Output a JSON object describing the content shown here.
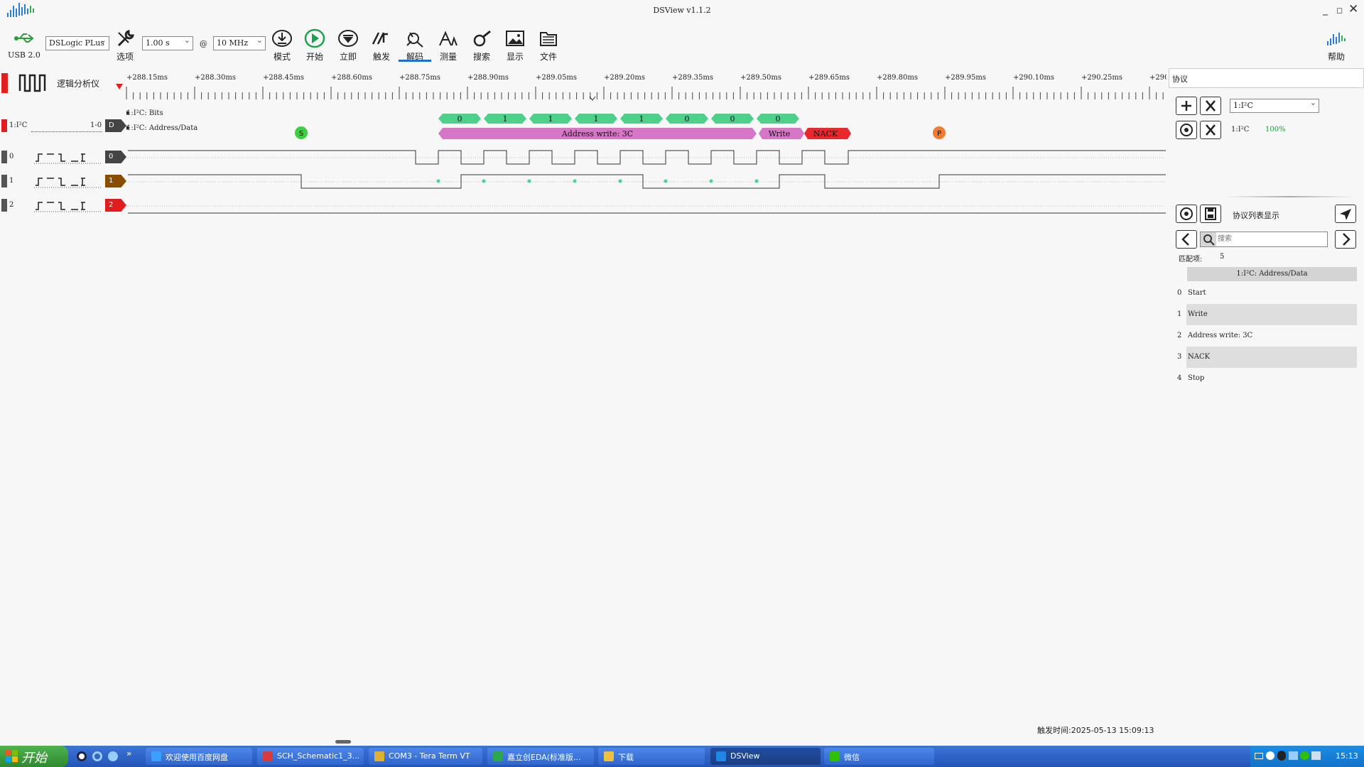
{
  "window": {
    "title": "DSView v1.1.2",
    "minimize": "_",
    "restore": "◻",
    "close": "✕"
  },
  "toolbar": {
    "usb_label": "USB 2.0",
    "device": "DSLogic PLus",
    "options": "选项",
    "duration": "1.00 s",
    "at": "@",
    "samplerate": "10 MHz",
    "mode": "模式",
    "start": "开始",
    "instant": "立即",
    "trigger": "触发",
    "decode": "解码",
    "measure": "测量",
    "search": "搜索",
    "display": "显示",
    "file": "文件",
    "help": "帮助"
  },
  "ruler": {
    "analyzer_label": "逻辑分析仪",
    "ticks": [
      "+288.15ms",
      "+288.30ms",
      "+288.45ms",
      "+288.60ms",
      "+288.75ms",
      "+288.90ms",
      "+289.05ms",
      "+289.20ms",
      "+289.35ms",
      "+289.50ms",
      "+289.65ms",
      "+289.80ms",
      "+289.95ms",
      "+290.10ms",
      "+290.25ms",
      "+290"
    ]
  },
  "decoder": {
    "name": "1:I²C",
    "range": "1-0",
    "tag": "D",
    "row_bits": "1:I²C: Bits",
    "row_addr": "1:I²C: Address/Data",
    "bits": [
      "0",
      "1",
      "1",
      "1",
      "1",
      "0",
      "0",
      "0"
    ],
    "start_marker": "S",
    "stop_marker": "P",
    "address_label": "Address write: 3C",
    "write_label": "Write",
    "nack_label": "NACK",
    "colors": {
      "bits": "#4fd08a",
      "address": "#d776c6",
      "nack": "#e8282a",
      "start": "#3ecf3e",
      "stop": "#f07a2e"
    }
  },
  "channels": [
    {
      "index": "0",
      "tag": "0",
      "color": "#444444"
    },
    {
      "index": "1",
      "tag": "1",
      "color": "#8a4d00"
    },
    {
      "index": "2",
      "tag": "2",
      "color": "#e01c1c"
    }
  ],
  "protocol_panel": {
    "header": "协议",
    "decoder_select": "1:I²C",
    "decoder_name": "1:I²C",
    "progress": "100%",
    "list_title": "协议列表显示",
    "search_placeholder": "搜索",
    "match_label": "匹配项:",
    "match_count": "5",
    "column_header": "1:I²C: Address/Data",
    "rows": [
      {
        "idx": "0",
        "text": "Start"
      },
      {
        "idx": "1",
        "text": "Write"
      },
      {
        "idx": "2",
        "text": "Address write: 3C"
      },
      {
        "idx": "3",
        "text": "NACK"
      },
      {
        "idx": "4",
        "text": "Stop"
      }
    ]
  },
  "status": {
    "trigger_time": "触发时间:2025-05-13 15:09:13"
  },
  "taskbar": {
    "start": "开始",
    "items": [
      {
        "label": "欢迎使用百度网盘",
        "color": "#3aa0ff"
      },
      {
        "label": "SCH_Schematic1_3...",
        "color": "#d83b3b"
      },
      {
        "label": "COM3 - Tera Term VT",
        "color": "#e0b030"
      },
      {
        "label": "嘉立创EDA(标准版...",
        "color": "#2aa84a"
      },
      {
        "label": "下载",
        "color": "#f0c040"
      },
      {
        "label": "DSView",
        "color": "#1e88e5"
      },
      {
        "label": "微信",
        "color": "#2dc100"
      }
    ],
    "clock": "15:13"
  }
}
